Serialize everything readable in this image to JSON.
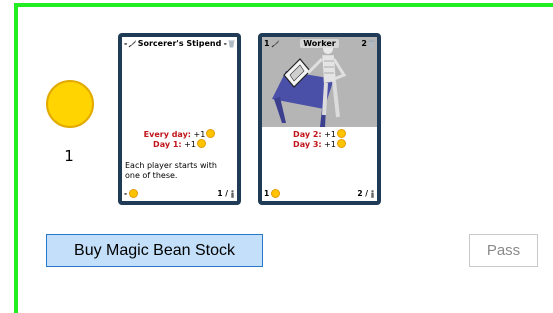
{
  "player": {
    "coin_count": "1"
  },
  "cards": [
    {
      "top_left": "-",
      "title": "Sorcerer's Stipend",
      "top_right": "-",
      "abilities": [
        {
          "label": "Every day:",
          "value": "+1"
        },
        {
          "label": "Day 1:",
          "value": "+1"
        }
      ],
      "description": "Each player starts with one of these.",
      "cost": "-",
      "supply": "1 /"
    },
    {
      "top_left": "1",
      "title": "Worker",
      "top_right": "2",
      "abilities": [
        {
          "label": "Day 2:",
          "value": "+1"
        },
        {
          "label": "Day 3:",
          "value": "+1"
        }
      ],
      "description": "",
      "cost": "1",
      "supply": "2 /"
    }
  ],
  "actions": {
    "buy_label": "Buy Magic Bean Stock",
    "pass_label": "Pass"
  },
  "colors": {
    "frame": "#22ee22",
    "coin": "#ffd400",
    "card_border": "#1f3b55",
    "ability_label": "#c0151a",
    "buy_bg": "#c4dff9",
    "buy_border": "#2a79c9"
  }
}
